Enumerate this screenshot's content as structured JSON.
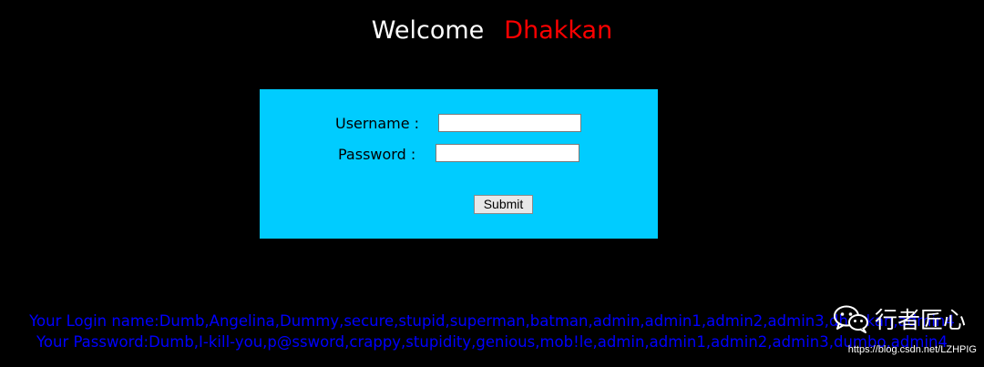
{
  "header": {
    "welcome_text": "Welcome",
    "user_name": "Dhakkan"
  },
  "login_form": {
    "username_label": "Username :",
    "username_value": "",
    "password_label": "Password :",
    "password_value": "",
    "submit_label": "Submit"
  },
  "result": {
    "login_names": "Your Login name:Dumb,Angelina,Dummy,secure,stupid,superman,batman,admin,admin1,admin2,admin3,dhakkan,admin4",
    "passwords": "Your Password:Dumb,I-kill-you,p@ssword,crappy,stupidity,genious,mob!le,admin,admin1,admin2,admin3,dumbo,admin4"
  },
  "watermark": {
    "channel_name": "行者匠心",
    "icon": "wechat-icon",
    "source_url": "https://blog.csdn.net/LZHPIG"
  },
  "colors": {
    "background": "#000000",
    "form_background": "#00ccff",
    "welcome_name": "#ff0000",
    "result_text": "#0000ff"
  }
}
